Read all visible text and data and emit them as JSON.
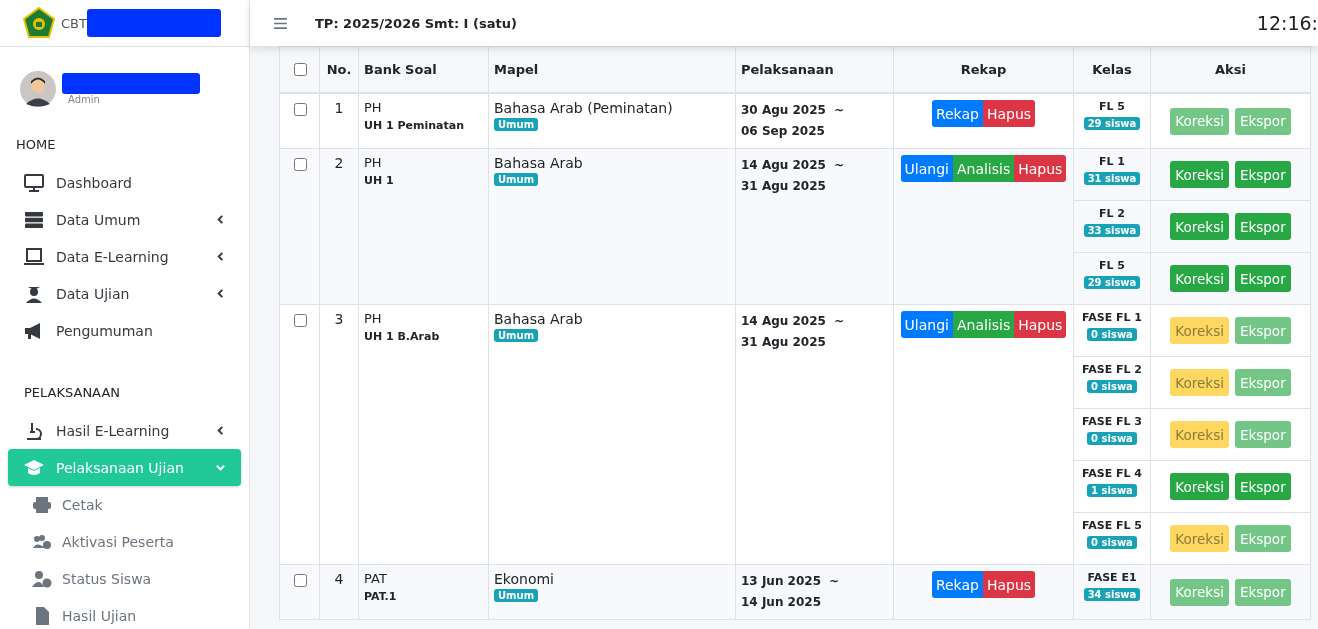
{
  "brand": {
    "text": "CBT"
  },
  "user": {
    "role": "Admin"
  },
  "sidebar": {
    "sections": [
      {
        "title": "HOME",
        "items": [
          {
            "label": "Dashboard",
            "selected": false
          },
          {
            "label": "Data Umum",
            "selected": false,
            "expanded": false
          },
          {
            "label": "Data E-Learning",
            "selected": false,
            "expanded": false
          },
          {
            "label": "Data Ujian",
            "selected": false,
            "expanded": false
          },
          {
            "label": "Pengumuman",
            "selected": false
          }
        ]
      },
      {
        "title": "PELAKSANAAN",
        "items": [
          {
            "label": "Hasil E-Learning",
            "selected": false,
            "expanded": false
          },
          {
            "label": "Pelaksanaan Ujian",
            "selected": true,
            "expanded": true,
            "children": [
              {
                "label": "Cetak"
              },
              {
                "label": "Aktivasi Peserta"
              },
              {
                "label": "Status Siswa"
              },
              {
                "label": "Hasil Ujian"
              }
            ]
          }
        ]
      }
    ]
  },
  "header": {
    "title": "TP: 2025/2026 Smt: I (satu)",
    "clock": "12:16:"
  },
  "table": {
    "select_all": {
      "checked": false
    },
    "columns": [
      "No.",
      "Bank Soal",
      "Mapel",
      "Pelaksanaan",
      "Rekap",
      "Kelas",
      "Aksi"
    ],
    "rows": [
      {
        "checked": false,
        "no": "1",
        "bank": "PH",
        "bank_code": "UH 1 Peminatan",
        "mapel": "Bahasa Arab (Peminatan)",
        "tag": "Umum",
        "start": "30 Agu 2025",
        "sep": "~",
        "end": "06 Sep 2025",
        "rekap": [
          {
            "label": "Rekap",
            "kind": "primary"
          },
          {
            "label": "Hapus",
            "kind": "danger"
          }
        ],
        "classes": [
          {
            "name": "FL 5",
            "count": "29 siswa",
            "kind": "disabled",
            "actions": [
              "Koreksi",
              "Ekspor"
            ]
          }
        ]
      },
      {
        "checked": false,
        "no": "2",
        "bank": "PH",
        "bank_code": "UH 1",
        "mapel": "Bahasa Arab",
        "tag": "Umum",
        "start": "14 Agu 2025",
        "sep": "~",
        "end": "31 Agu 2025",
        "rekap": [
          {
            "label": "Ulangi",
            "kind": "primary"
          },
          {
            "label": "Analisis",
            "kind": "success"
          },
          {
            "label": "Hapus",
            "kind": "danger"
          }
        ],
        "classes": [
          {
            "name": "FL 1",
            "count": "31 siswa",
            "kind": "active",
            "actions": [
              "Koreksi",
              "Ekspor"
            ]
          },
          {
            "name": "FL 2",
            "count": "33 siswa",
            "kind": "active",
            "actions": [
              "Koreksi",
              "Ekspor"
            ]
          },
          {
            "name": "FL 5",
            "count": "29 siswa",
            "kind": "active",
            "actions": [
              "Koreksi",
              "Ekspor"
            ]
          }
        ]
      },
      {
        "checked": false,
        "no": "3",
        "bank": "PH",
        "bank_code": "UH 1 B.Arab",
        "mapel": "Bahasa Arab",
        "tag": "Umum",
        "start": "14 Agu 2025",
        "sep": "~",
        "end": "31 Agu 2025",
        "rekap": [
          {
            "label": "Ulangi",
            "kind": "primary"
          },
          {
            "label": "Analisis",
            "kind": "success"
          },
          {
            "label": "Hapus",
            "kind": "danger"
          }
        ],
        "classes": [
          {
            "name": "FASE FL 1",
            "count": "0 siswa",
            "kind": "warning",
            "actions": [
              "Koreksi",
              "Ekspor"
            ]
          },
          {
            "name": "FASE FL 2",
            "count": "0 siswa",
            "kind": "warning",
            "actions": [
              "Koreksi",
              "Ekspor"
            ]
          },
          {
            "name": "FASE FL 3",
            "count": "0 siswa",
            "kind": "warning",
            "actions": [
              "Koreksi",
              "Ekspor"
            ]
          },
          {
            "name": "FASE FL 4",
            "count": "1 siswa",
            "kind": "active",
            "actions": [
              "Koreksi",
              "Ekspor"
            ]
          },
          {
            "name": "FASE FL 5",
            "count": "0 siswa",
            "kind": "warning",
            "actions": [
              "Koreksi",
              "Ekspor"
            ]
          }
        ]
      },
      {
        "checked": false,
        "no": "4",
        "bank": "PAT",
        "bank_code": "PAT.1",
        "mapel": "Ekonomi",
        "tag": "Umum",
        "start": "13 Jun 2025",
        "sep": "~",
        "end": "14 Jun 2025",
        "rekap": [
          {
            "label": "Rekap",
            "kind": "primary"
          },
          {
            "label": "Hapus",
            "kind": "danger"
          }
        ],
        "classes": [
          {
            "name": "FASE E1",
            "count": "34 siswa",
            "kind": "disabled",
            "actions": [
              "Koreksi",
              "Ekspor"
            ]
          }
        ]
      }
    ]
  }
}
